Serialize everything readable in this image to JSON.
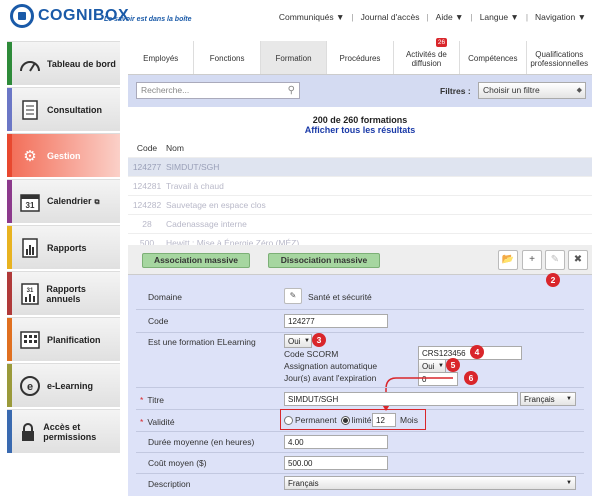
{
  "brand": {
    "name": "COGNIBOX",
    "tagline": "Le savoir est dans la boîte"
  },
  "topnav": [
    "Communiqués ▼",
    "Journal d'accès",
    "Aide ▼",
    "Langue ▼",
    "Navigation ▼"
  ],
  "sidebar": {
    "items": [
      {
        "label": "Tableau de bord",
        "color": "#2e8b3a",
        "icon": "dashboard-icon"
      },
      {
        "label": "Consultation",
        "color": "#6b77c6",
        "icon": "document-icon"
      },
      {
        "label": "Gestion",
        "color": "#e8482f",
        "icon": "gear-icon"
      },
      {
        "label": "Calendrier",
        "color": "#8c3a8c",
        "icon": "calendar-icon",
        "day": "31"
      },
      {
        "label": "Rapports",
        "color": "#e8b320",
        "icon": "bar-chart-icon"
      },
      {
        "label": "Rapports annuels",
        "color": "#b03a3a",
        "icon": "annual-report-icon",
        "day": "31"
      },
      {
        "label": "Planification",
        "color": "#e07020",
        "icon": "planning-icon"
      },
      {
        "label": "e-Learning",
        "color": "#9a9a3a",
        "icon": "elearning-icon"
      },
      {
        "label": "Accès et permissions",
        "color": "#3a6ab0",
        "icon": "lock-icon"
      }
    ]
  },
  "tabs": [
    {
      "label": "Employés"
    },
    {
      "label": "Fonctions"
    },
    {
      "label": "Formation"
    },
    {
      "label": "Procédures"
    },
    {
      "label": "Activités de diffusion",
      "badge": "26"
    },
    {
      "label": "Compétences"
    },
    {
      "label": "Qualifications professionnelles"
    }
  ],
  "search": {
    "placeholder": "Recherche...",
    "filter_label": "Filtres :",
    "filter_value": "Choisir un filtre"
  },
  "results": {
    "count": "200 de 260 formations",
    "show_all": "Afficher tous les résultats"
  },
  "table": {
    "headers": [
      "Code",
      "Nom"
    ],
    "rows": [
      {
        "code": "124277",
        "name": "SIMDUT/SGH"
      },
      {
        "code": "124281",
        "name": "Travail à chaud"
      },
      {
        "code": "124282",
        "name": "Sauvetage en espace clos"
      },
      {
        "code": "28",
        "name": "Cadenassage interne"
      },
      {
        "code": "500",
        "name": "Hewitt : Mise à Énergie Zéro (MÉZ)"
      }
    ]
  },
  "toolbar": {
    "assoc": "Association massive",
    "dissoc": "Dissociation massive"
  },
  "form": {
    "domaine_label": "Domaine",
    "domaine_value": "Santé et sécurité",
    "code_label": "Code",
    "code_value": "124277",
    "elearning_label": "Est une formation ELearning",
    "elearning_value": "Oui",
    "scorm_label": "Code SCORM",
    "scorm_value": "CRS123456",
    "auto_label": "Assignation automatique",
    "auto_value": "Oui",
    "days_label": "Jour(s) avant l'expiration",
    "days_value": "0",
    "titre_label": "Titre",
    "titre_value": "SIMDUT/SGH",
    "lang_value": "Français",
    "validite_label": "Validité",
    "permanent": "Permanent",
    "limite": "limité",
    "limite_value": "12",
    "mois": "Mois",
    "duree_label": "Durée moyenne (en heures)",
    "duree_value": "4.00",
    "cout_label": "Coût moyen ($)",
    "cout_value": "500.00",
    "desc_label": "Description",
    "desc_lang": "Français",
    "required_mark": "*"
  },
  "annotations": [
    "2",
    "3",
    "4",
    "5",
    "6"
  ]
}
